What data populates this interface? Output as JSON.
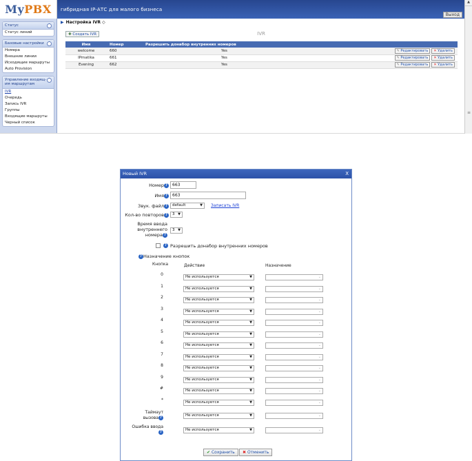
{
  "app": {
    "logo_my": "My",
    "logo_pbx": "PBX",
    "subtitle": "гибридная IP-АТС для малого бизнеса",
    "logout": "Выход"
  },
  "sidebar": {
    "groups": [
      {
        "title": "Статус",
        "items": [
          "Статус линий"
        ]
      },
      {
        "title": "Базовые настройки",
        "items": [
          "Номера",
          "Внешние линии",
          "Исходящие маршруты",
          "Auto Provision"
        ]
      },
      {
        "title": "Управление входящ-им маршрутам",
        "items": [
          "IVR",
          "Очередь",
          "Запись IVR",
          "Группы",
          "Входящие маршруты",
          "Черный список"
        ]
      }
    ]
  },
  "content": {
    "breadcrumb": "Настройка IVR",
    "section_title": "IVR",
    "create_button": "Создать IVR",
    "columns": [
      "Имя",
      "Номер",
      "Разрешить донабор внутренних номеров"
    ],
    "rows": [
      {
        "name": "welcome",
        "number": "660",
        "allow": "Yes"
      },
      {
        "name": "IPmatika",
        "number": "661",
        "allow": "Yes"
      },
      {
        "name": "Evening",
        "number": "662",
        "allow": "Yes"
      }
    ],
    "edit_label": "Редактировать",
    "delete_label": "Удалить"
  },
  "dialog": {
    "title": "Новый IVR",
    "close": "X",
    "number_label": "Номер",
    "number_value": "663",
    "name_label": "Имя",
    "name_value": "663",
    "sound_label": "Звук. файл",
    "sound_value": "default",
    "record_link": "Записать IVR",
    "repeat_label": "Кол-во повторов",
    "repeat_value": "3",
    "input_time_label_1": "Время ввода",
    "input_time_label_2": "внутреннего",
    "input_time_label_3": "номера",
    "input_time_value": "3",
    "allow_label": "Разрешить донабор внутренних номеров",
    "keymap_header": "Назначение кнопок",
    "col_key": "Кнопка",
    "col_action": "Действие",
    "col_dest": "Назначение",
    "not_used": "Не используется",
    "keys": [
      "0",
      "1",
      "2",
      "3",
      "4",
      "5",
      "6",
      "7",
      "8",
      "9",
      "#",
      "*"
    ],
    "timeout_label_1": "Таймаут",
    "timeout_label_2": "вызова",
    "error_label_1": "Ошибка ввода",
    "save_button": "Сохранить",
    "cancel_button": "Отменить"
  }
}
